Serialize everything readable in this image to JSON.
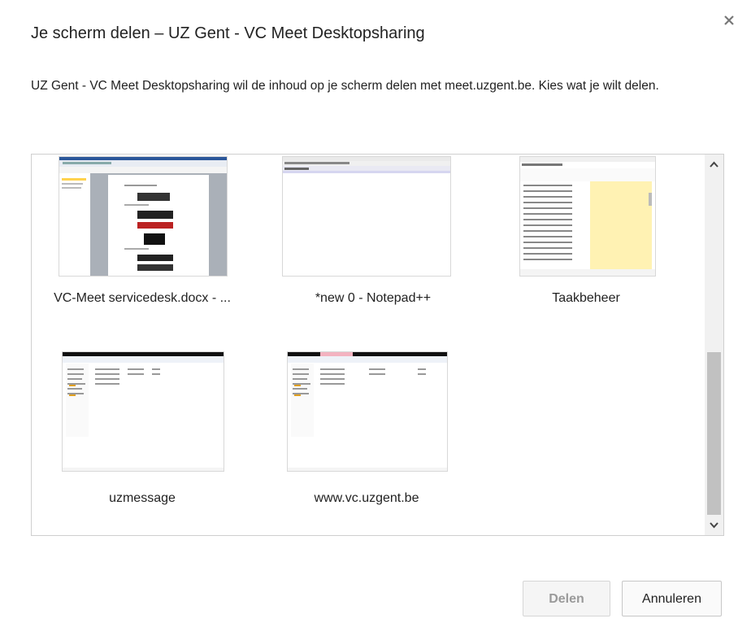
{
  "dialog": {
    "title": "Je scherm delen – UZ Gent - VC Meet Desktopsharing",
    "description": "UZ Gent - VC Meet Desktopsharing wil de inhoud op je scherm delen met meet.uzgent.be. Kies wat je wilt delen.",
    "close_icon": "close-icon"
  },
  "windows": [
    {
      "label": "VC-Meet servicedesk.docx - ...",
      "kind": "word"
    },
    {
      "label": "*new 0 - Notepad++",
      "kind": "notepad"
    },
    {
      "label": "Taakbeheer",
      "kind": "taskmanager"
    },
    {
      "label": "uzmessage",
      "kind": "explorer"
    },
    {
      "label": "www.vc.uzgent.be",
      "kind": "explorer"
    }
  ],
  "buttons": {
    "share_label": "Delen",
    "cancel_label": "Annuleren"
  },
  "scrollbar": {
    "up_icon": "chevron-up-icon",
    "down_icon": "chevron-down-icon"
  }
}
